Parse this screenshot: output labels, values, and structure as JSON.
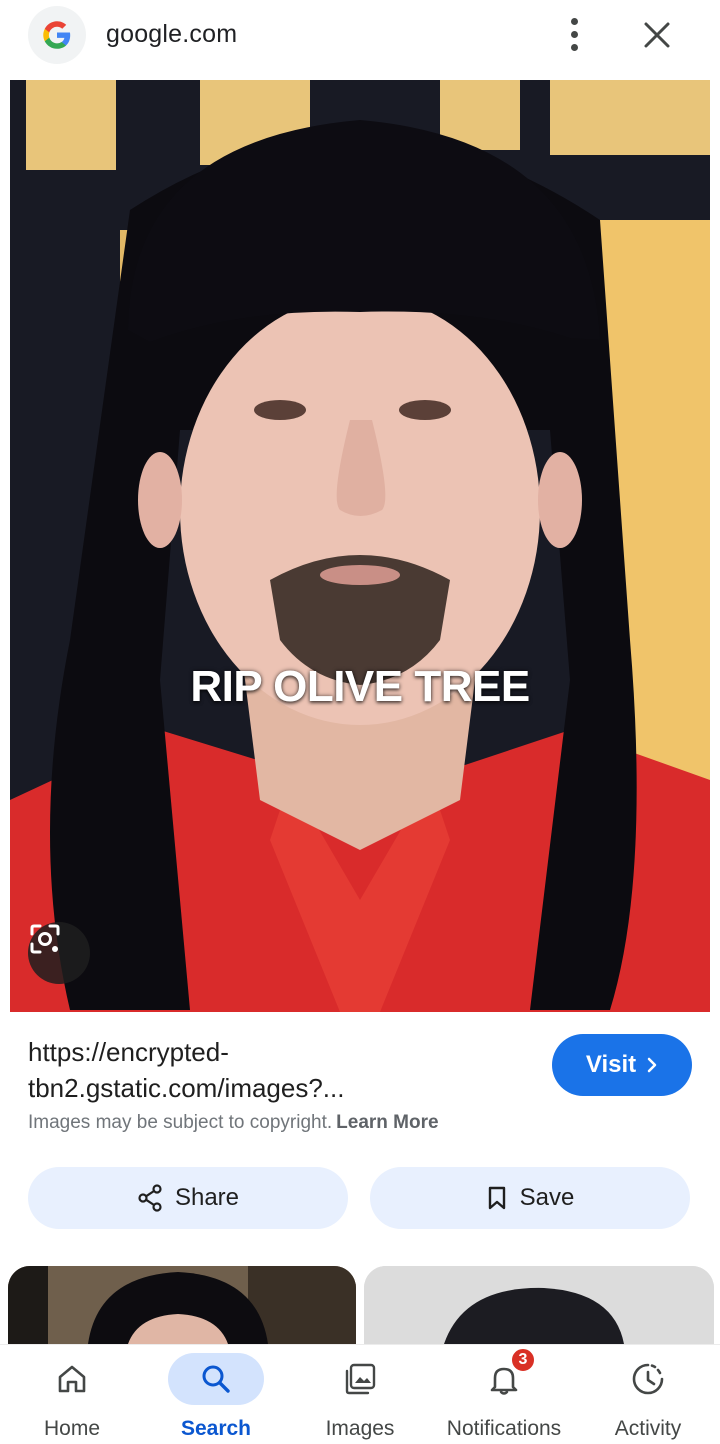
{
  "header": {
    "domain": "google.com",
    "logo_letter": "G"
  },
  "image": {
    "caption": "RIP OLIVE TREE"
  },
  "result": {
    "url": "https://encrypted-tbn2.gstatic.com/images?...",
    "visit_label": "Visit",
    "copyright_text": "Images may be subject to copyright.",
    "learn_more": "Learn More"
  },
  "actions": {
    "share_label": "Share",
    "save_label": "Save"
  },
  "bottom_nav": {
    "items": [
      {
        "label": "Home",
        "icon": "home-icon"
      },
      {
        "label": "Search",
        "icon": "search-icon",
        "active": true
      },
      {
        "label": "Images",
        "icon": "images-icon"
      },
      {
        "label": "Notifications",
        "icon": "bell-icon",
        "badge": "3"
      },
      {
        "label": "Activity",
        "icon": "activity-icon"
      }
    ]
  },
  "colors": {
    "accent": "#1a73e8",
    "active_nav": "#0b57d0",
    "badge": "#d93025",
    "shirt": "#d92b2b",
    "backdrop": "#f0c46a"
  }
}
